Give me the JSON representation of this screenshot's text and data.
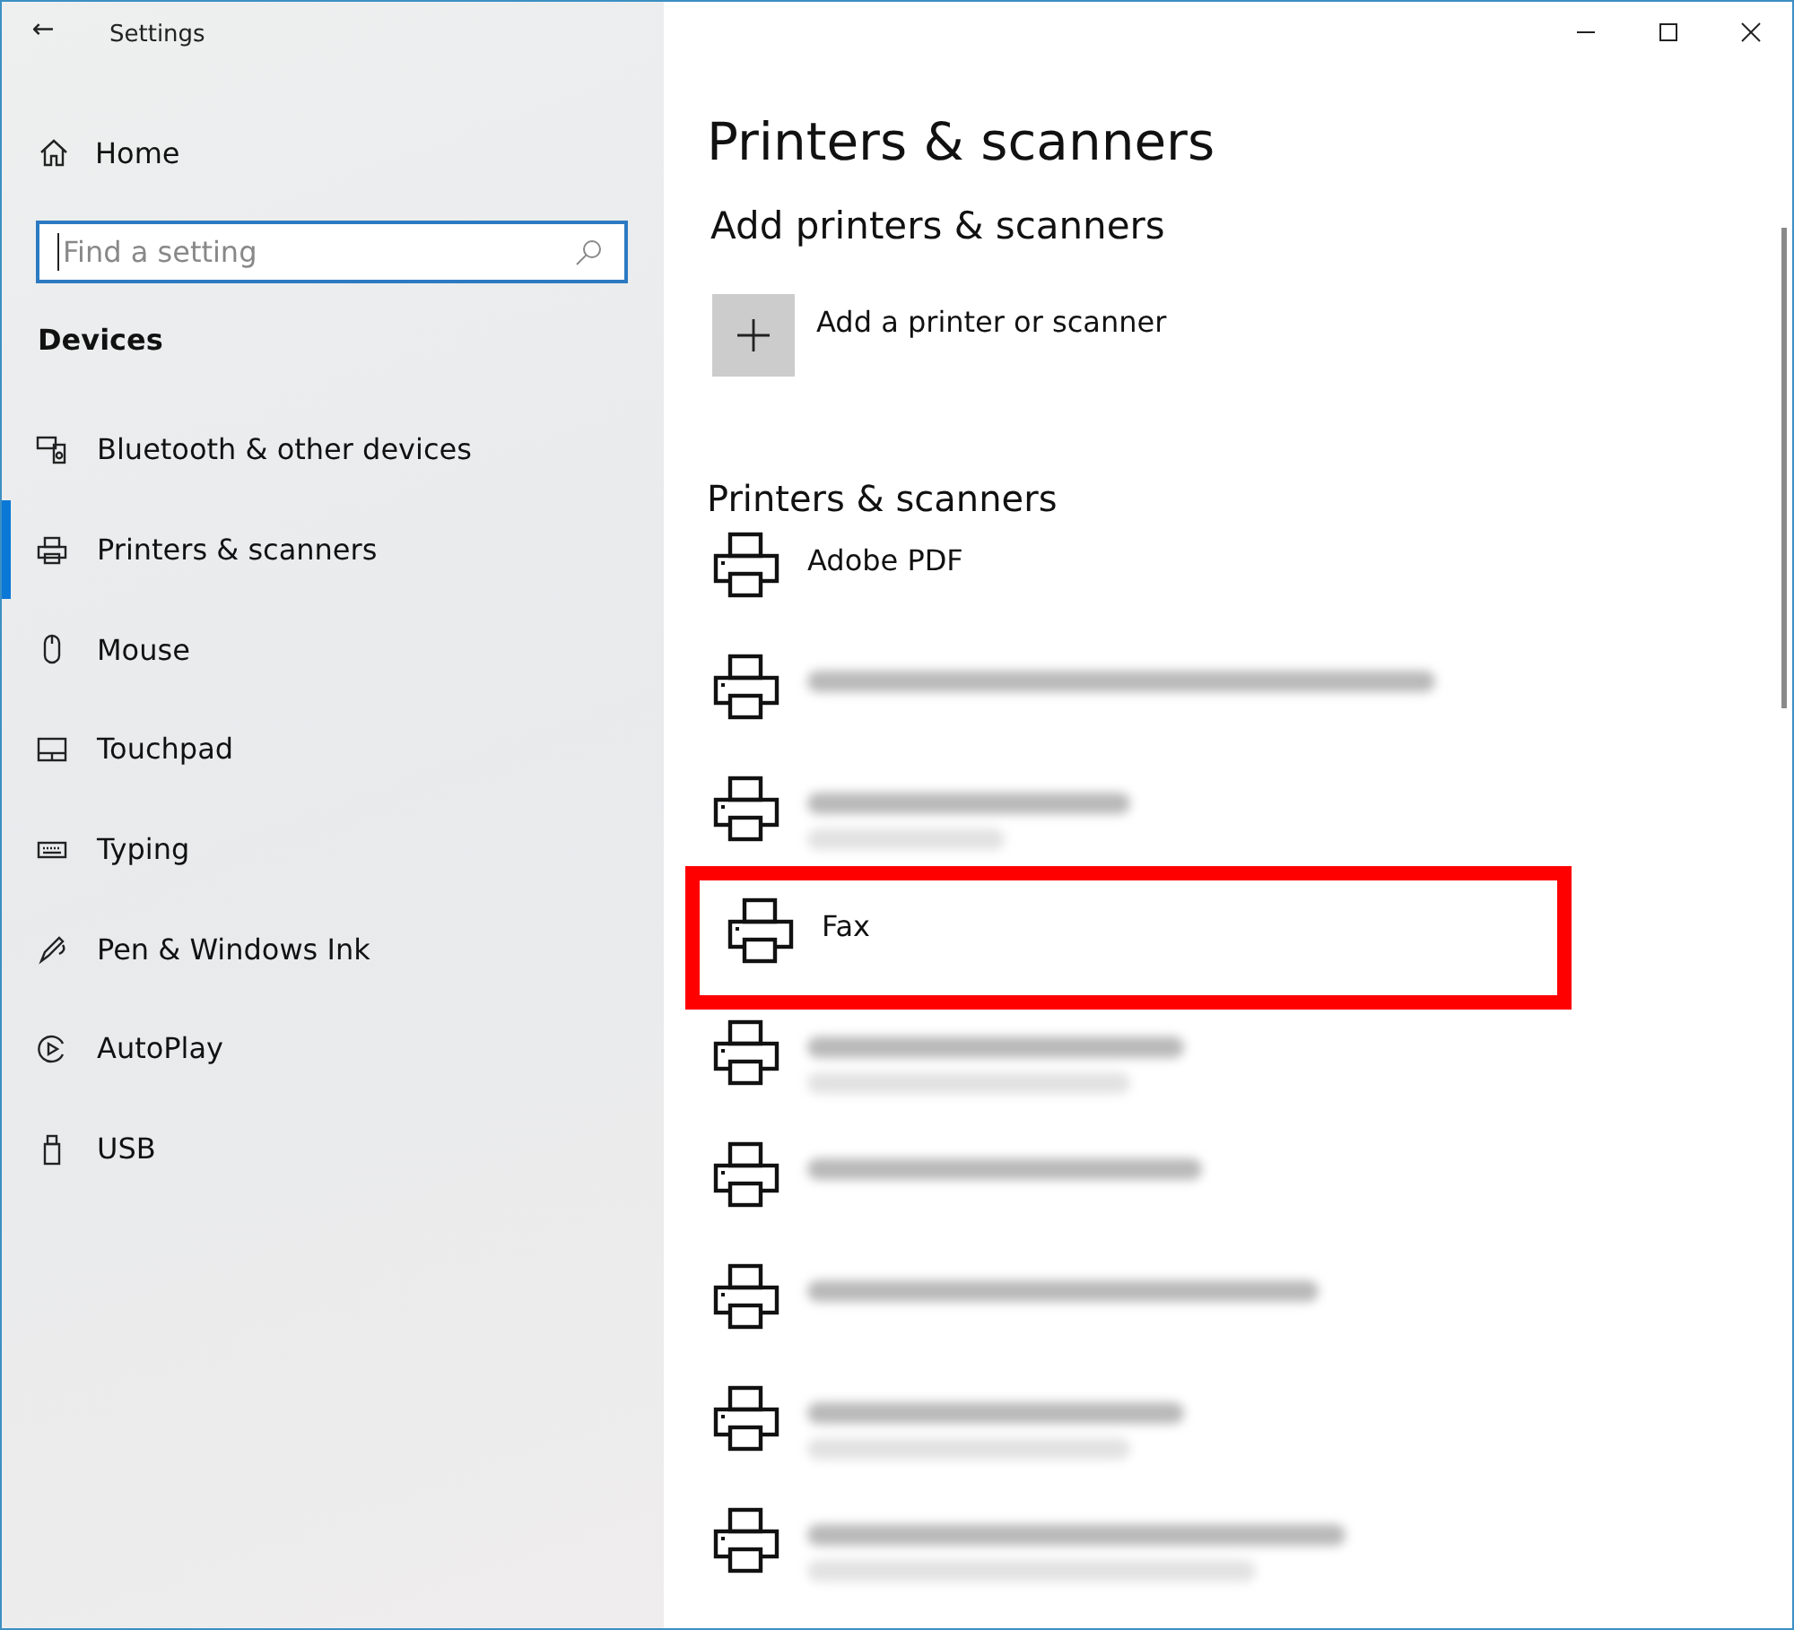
{
  "window": {
    "title": "Settings",
    "back": "←"
  },
  "sidebar": {
    "home": "Home",
    "search": {
      "placeholder": "Find a setting"
    },
    "section": "Devices",
    "items": [
      {
        "label": "Bluetooth & other devices",
        "kind": "bluetooth",
        "selected": false
      },
      {
        "label": "Printers & scanners",
        "kind": "printer",
        "selected": true
      },
      {
        "label": "Mouse",
        "kind": "mouse",
        "selected": false
      },
      {
        "label": "Touchpad",
        "kind": "touchpad",
        "selected": false
      },
      {
        "label": "Typing",
        "kind": "keyboard",
        "selected": false
      },
      {
        "label": "Pen & Windows Ink",
        "kind": "pen",
        "selected": false
      },
      {
        "label": "AutoPlay",
        "kind": "autoplay",
        "selected": false
      },
      {
        "label": "USB",
        "kind": "usb",
        "selected": false
      }
    ]
  },
  "main": {
    "title": "Printers & scanners",
    "add_heading": "Add printers & scanners",
    "add_label": "Add a printer or scanner",
    "list_heading": "Printers & scanners",
    "printers": [
      {
        "kind": "named",
        "name": "Adobe PDF",
        "highlighted": false
      },
      {
        "kind": "blurred",
        "status_line": false,
        "highlighted": false
      },
      {
        "kind": "blurred",
        "status_line": true,
        "highlighted": false
      },
      {
        "kind": "named",
        "name": "Fax",
        "highlighted": true
      },
      {
        "kind": "blurred",
        "status_line": true,
        "highlighted": false
      },
      {
        "kind": "blurred",
        "status_line": false,
        "highlighted": false
      },
      {
        "kind": "blurred",
        "status_line": false,
        "highlighted": false
      },
      {
        "kind": "blurred",
        "status_line": true,
        "highlighted": false
      },
      {
        "kind": "blurred",
        "status_line": true,
        "highlighted": false
      }
    ]
  }
}
